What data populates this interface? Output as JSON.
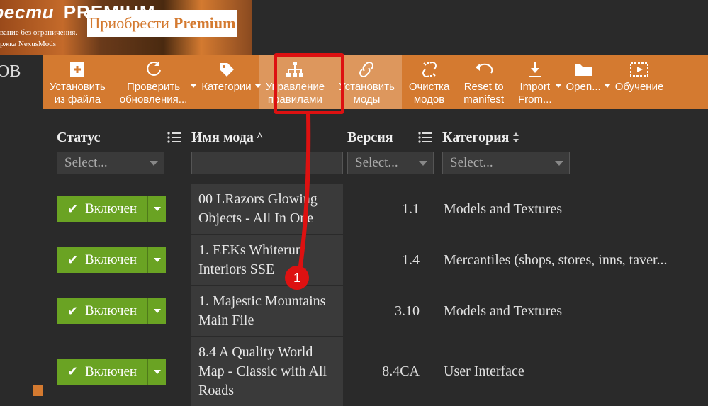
{
  "banner": {
    "title_fragment": "иобрести",
    "premium_word": "PREMIUM",
    "subtitle1": "вание без ограничения.",
    "subtitle2": "ржка NexusMods",
    "cta_prefix": "Приобрести",
    "cta_bold": "Premium"
  },
  "sidebar_fragment": "ОВ",
  "toolbar": [
    {
      "key": "install-file",
      "line1": "Установить",
      "line2": "из файла",
      "icon": "plus"
    },
    {
      "key": "check-updates",
      "line1": "Проверить",
      "line2": "обновления...",
      "icon": "refresh",
      "has_caret": true
    },
    {
      "key": "categories",
      "line1": "Категории",
      "line2": "",
      "icon": "tag",
      "has_caret": true
    },
    {
      "key": "manage-rules",
      "line1": "Управление",
      "line2": "правилами",
      "icon": "hierarchy",
      "selected": true
    },
    {
      "key": "install-mods",
      "line1": "Установить",
      "line2": "моды",
      "icon": "link",
      "selected": true,
      "highlighted": true
    },
    {
      "key": "purge-mods",
      "line1": "Очистка",
      "line2": "модов",
      "icon": "unlink"
    },
    {
      "key": "reset-manifest",
      "line1": "Reset to",
      "line2": "manifest",
      "icon": "undo"
    },
    {
      "key": "import-from",
      "line1": "Import",
      "line2": "From...",
      "icon": "download",
      "has_caret": true
    },
    {
      "key": "open",
      "line1": "Open...",
      "line2": "",
      "icon": "folder",
      "has_caret": true
    },
    {
      "key": "tutorial",
      "line1": "Обучение",
      "line2": "",
      "icon": "video"
    }
  ],
  "annotation": {
    "number": "1"
  },
  "columns": {
    "status": "Статус",
    "name": "Имя мода",
    "version": "Версия",
    "category": "Категория"
  },
  "filters": {
    "status_placeholder": "Select...",
    "version_placeholder": "Select...",
    "category_placeholder": "Select..."
  },
  "status_label": "Включен",
  "mods": [
    {
      "name": "00 LRazors Glowing Objects - All In One",
      "version": "1.1",
      "category": "Models and Textures"
    },
    {
      "name": "1. EEKs Whiterun Interiors SSE",
      "version": "1.4",
      "category": "Mercantiles (shops, stores, inns, taver..."
    },
    {
      "name": "1. Majestic Mountains Main File",
      "version": "3.10",
      "category": "Models and Textures"
    },
    {
      "name": "8.4 A Quality World Map - Classic with All Roads",
      "version": "8.4CA",
      "category": "User Interface"
    }
  ]
}
